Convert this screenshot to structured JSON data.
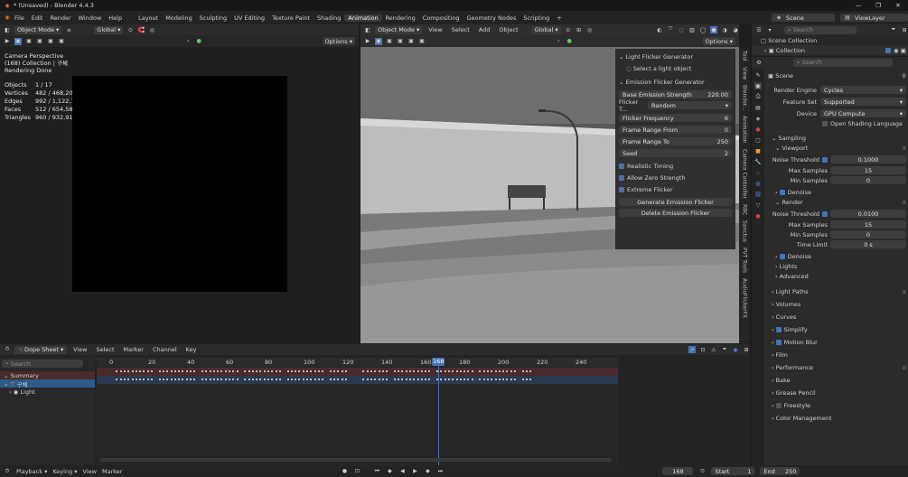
{
  "titlebar": {
    "title": "* (Unsaved) - Blender 4.4.3",
    "min": "—",
    "max": "❐",
    "close": "✕"
  },
  "menu": [
    "File",
    "Edit",
    "Render",
    "Window",
    "Help"
  ],
  "workspaces": [
    "Layout",
    "Modeling",
    "Sculpting",
    "UV Editing",
    "Texture Paint",
    "Shading",
    "Animation",
    "Rendering",
    "Compositing",
    "Geometry Nodes",
    "Scripting"
  ],
  "active_workspace": "Animation",
  "scene": "Scene",
  "view_layer": "ViewLayer",
  "left_view": {
    "mode": "Object Mode",
    "transform": "Global",
    "options": "Options",
    "cam": "Camera Perspective",
    "collection": "(168) Collection | 구체",
    "render_status": "Rendering Done",
    "stats": [
      [
        "Objects",
        "1 / 17"
      ],
      [
        "Vertices",
        "482 / 468,205"
      ],
      [
        "Edges",
        "992 / 1,122,796"
      ],
      [
        "Faces",
        "512 / 654,589"
      ],
      [
        "Triangles",
        "960 / 932,913"
      ]
    ]
  },
  "mid_view": {
    "mode": "Object Mode",
    "menus": [
      "View",
      "Select",
      "Add",
      "Object"
    ],
    "transform": "Global",
    "options": "Options"
  },
  "npanel": {
    "light_section": "Light Flicker Generator",
    "light_hint": "Select a light object",
    "emission_section": "Emission Flicker Generator",
    "base_label": "Base Emission Strength",
    "base_value": "220.00",
    "flicker_type_label": "Flicker T...",
    "flicker_type_value": "Random",
    "fields": [
      [
        "Flicker Frequency",
        "6"
      ],
      [
        "Frame Range From",
        "0"
      ],
      [
        "Frame Range To",
        "250"
      ],
      [
        "Seed",
        "2"
      ]
    ],
    "checks": [
      "Realistic Timing",
      "Allow Zero Strength",
      "Extreme Flicker"
    ],
    "generate": "Generate Emission Flicker",
    "delete": "Delete Emission Flicker"
  },
  "side_tabs": [
    "Tool",
    "View",
    "Blender...",
    "Animation",
    "Camera Controller",
    "RBC",
    "Sanctus",
    "PVT Tools",
    "AudioFlickerFX"
  ],
  "outliner": {
    "search": "Search",
    "root": "Scene Collection",
    "child": "Collection"
  },
  "props": {
    "search": "Search",
    "scene": "Scene",
    "engine_label": "Render Engine",
    "engine": "Cycles",
    "feature_label": "Feature Set",
    "feature": "Supported",
    "device_label": "Device",
    "device": "GPU Compute",
    "osl": "Open Shading Language",
    "sampling": "Sampling",
    "viewport": "Viewport",
    "vp_noise_label": "Noise Threshold",
    "vp_noise": "0.1000",
    "vp_max_label": "Max Samples",
    "vp_max": "15",
    "vp_min_label": "Min Samples",
    "vp_min": "0",
    "denoise": "Denoise",
    "render": "Render",
    "r_noise_label": "Noise Threshold",
    "r_noise": "0.0100",
    "r_max_label": "Max Samples",
    "r_max": "15",
    "r_min_label": "Min Samples",
    "r_min": "0",
    "time_label": "Time Limit",
    "time": "0 s",
    "denoise2": "Denoise",
    "lights": "Lights",
    "advanced": "Advanced",
    "sections": [
      "Light Paths",
      "Volumes",
      "Curves",
      "Simplify",
      "Motion Blur",
      "Film",
      "Performance",
      "Bake",
      "Grease Pencil",
      "Freestyle",
      "Color Management"
    ]
  },
  "dopesheet": {
    "editor": "Dope Sheet",
    "menus": [
      "View",
      "Select",
      "Marker",
      "Channel",
      "Key"
    ],
    "search": "Search",
    "channels": [
      "Summary",
      "구체",
      "Light"
    ],
    "ticks": [
      "0",
      "20",
      "40",
      "60",
      "80",
      "100",
      "120",
      "140",
      "160",
      "180",
      "200",
      "220",
      "240"
    ],
    "current_frame": "168"
  },
  "footer": {
    "playback": "Playback",
    "keying": "Keying",
    "view": "View",
    "marker": "Marker",
    "frame": "168",
    "start_label": "Start",
    "start": "1",
    "end_label": "End",
    "end": "250"
  }
}
